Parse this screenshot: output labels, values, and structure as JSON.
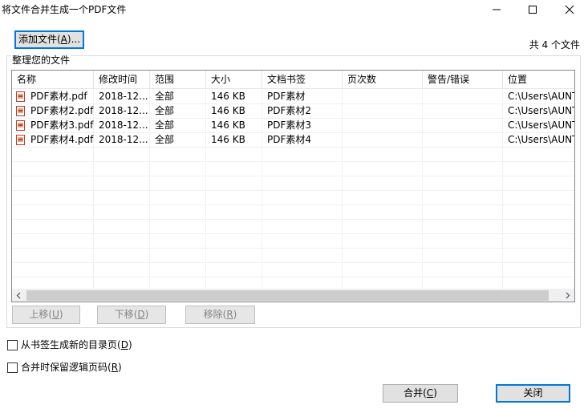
{
  "window": {
    "title": "将文件合并生成一个PDF文件"
  },
  "toolbar": {
    "add_label": "添加文件(",
    "add_key": "A",
    "add_tail": ")..."
  },
  "file_count": "共 4 个文件",
  "group_label": "整理您的文件",
  "table": {
    "columns": [
      "名称",
      "修改时间",
      "范围",
      "大小",
      "文档书签",
      "页次数",
      "警告/错误",
      "位置"
    ],
    "rows": [
      {
        "name": "PDF素材.pdf",
        "modified": "2018-12...",
        "range": "全部",
        "size": "146 KB",
        "bookmark": "PDF素材",
        "pages": "",
        "warning": "",
        "location": "C:\\Users\\AUNT"
      },
      {
        "name": "PDF素材2.pdf",
        "modified": "2018-12...",
        "range": "全部",
        "size": "146 KB",
        "bookmark": "PDF素材2",
        "pages": "",
        "warning": "",
        "location": "C:\\Users\\AUNT"
      },
      {
        "name": "PDF素材3.pdf",
        "modified": "2018-12...",
        "range": "全部",
        "size": "146 KB",
        "bookmark": "PDF素材3",
        "pages": "",
        "warning": "",
        "location": "C:\\Users\\AUNT"
      },
      {
        "name": "PDF素材4.pdf",
        "modified": "2018-12...",
        "range": "全部",
        "size": "146 KB",
        "bookmark": "PDF素材4",
        "pages": "",
        "warning": "",
        "location": "C:\\Users\\AUNT"
      }
    ]
  },
  "row_buttons": {
    "up": {
      "label": "上移(",
      "key": "U",
      "tail": ")"
    },
    "down": {
      "label": "下移(",
      "key": "D",
      "tail": ")"
    },
    "remove": {
      "label": "移除(",
      "key": "R",
      "tail": ")"
    }
  },
  "options": {
    "toc": {
      "label": "从书签生成新的目录页(",
      "key": "D",
      "tail": ")",
      "checked": false
    },
    "logical": {
      "label": "合并时保留逻辑页码(",
      "key": "R",
      "tail": ")",
      "checked": false
    }
  },
  "footer": {
    "merge": {
      "label": "合并(",
      "key": "C",
      "tail": ")"
    },
    "close": {
      "label": "关闭"
    }
  },
  "icons": {
    "file": "pdf-file-icon",
    "min": "minimize-icon",
    "max": "maximize-icon",
    "close": "close-icon"
  }
}
